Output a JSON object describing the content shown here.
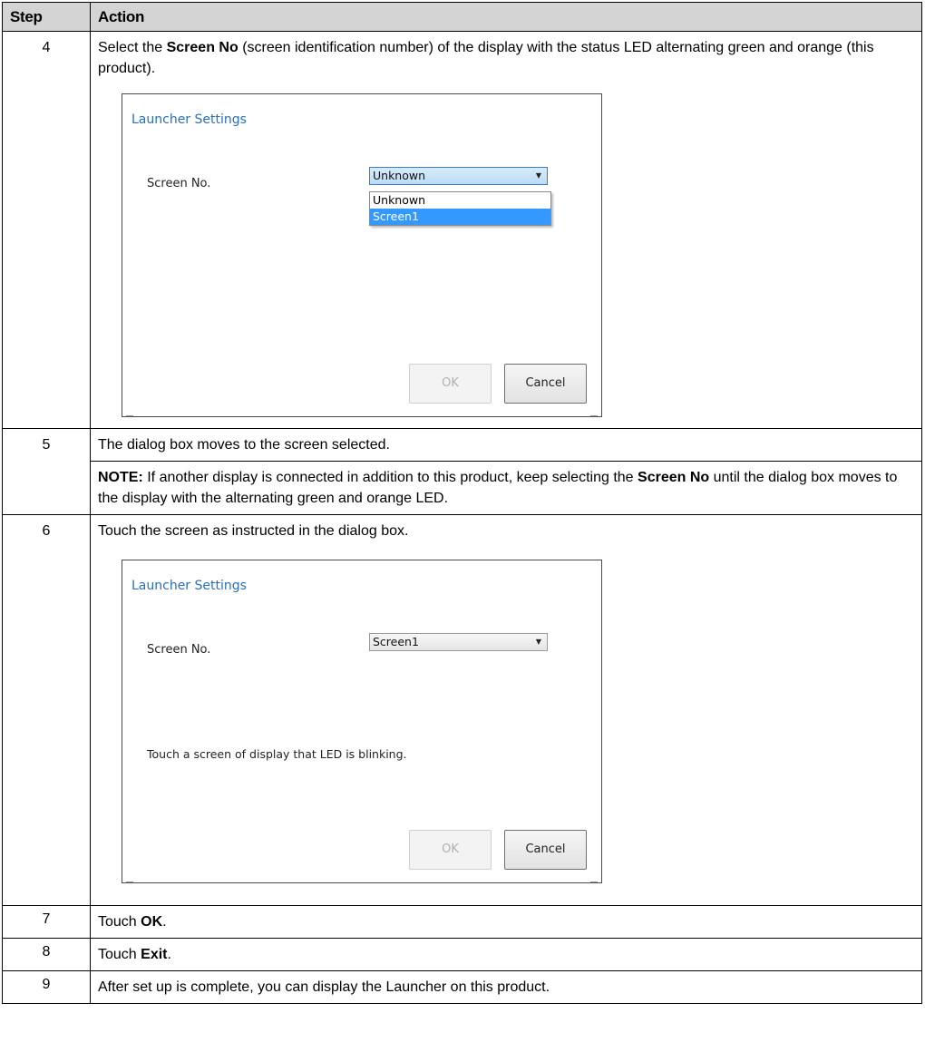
{
  "table": {
    "headers": {
      "step": "Step",
      "action": "Action"
    },
    "rows": {
      "r4": {
        "step": "4",
        "text_pre": "Select the ",
        "text_bold": "Screen No",
        "text_post": " (screen identification number) of the display with the status LED alternating green and orange (this product)."
      },
      "r5": {
        "step": "5",
        "text": "The dialog box moves to the screen selected.",
        "note_label": "NOTE:",
        "note_pre": " If another display is connected in addition to this product, keep selecting the ",
        "note_bold": "Screen No",
        "note_post": " until the dialog box moves to the display with the alternating green and orange LED."
      },
      "r6": {
        "step": "6",
        "text": "Touch the screen as instructed in the dialog box."
      },
      "r7": {
        "step": "7",
        "text_pre": "Touch ",
        "text_bold": "OK",
        "text_post": "."
      },
      "r8": {
        "step": "8",
        "text_pre": "Touch ",
        "text_bold": "Exit",
        "text_post": "."
      },
      "r9": {
        "step": "9",
        "text": "After set up is complete, you can display the Launcher on this product."
      }
    }
  },
  "dialog1": {
    "title": "Launcher Settings",
    "label": "Screen No.",
    "select_value": "Unknown",
    "options": [
      "Unknown",
      "Screen1"
    ],
    "selected_option": "Screen1",
    "ok": "OK",
    "cancel": "Cancel"
  },
  "dialog2": {
    "title": "Launcher Settings",
    "label": "Screen No.",
    "select_value": "Screen1",
    "message": "Touch a screen of display that LED is blinking.",
    "ok": "OK",
    "cancel": "Cancel"
  },
  "icons": {
    "dropdown": "triangle-down-icon"
  }
}
